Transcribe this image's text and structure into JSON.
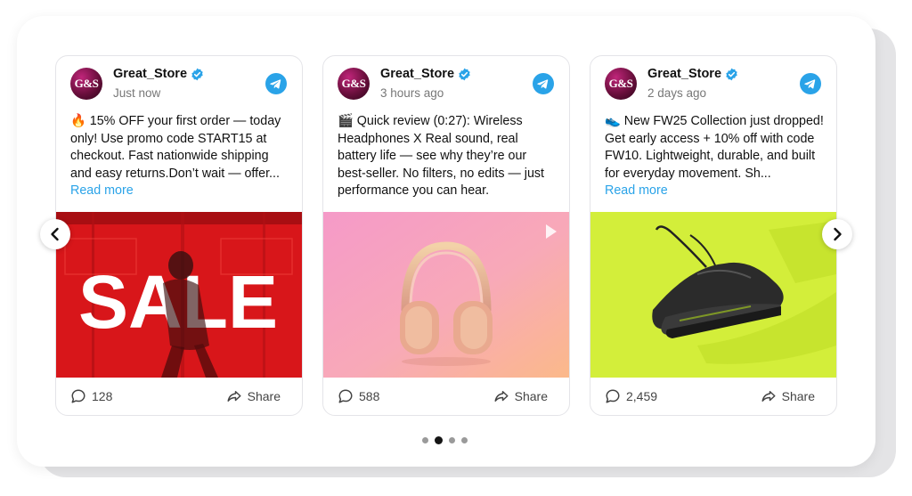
{
  "store": {
    "name": "Great_Store",
    "avatar_text": "G&S"
  },
  "posts": [
    {
      "time": "Just now",
      "text": "🔥 15% OFF your first order — today only! Use promo code START15 at checkout. Fast nationwide shipping and easy returns.Don’t wait — offer...",
      "read_more": "Read more",
      "media": {
        "type": "image",
        "big_text": "SALE",
        "description_icon": "sale-photo"
      },
      "comments": "128",
      "share": "Share"
    },
    {
      "time": "3 hours ago",
      "text": "🎬 Quick review (0:27): Wireless Headphones X Real sound, real battery life — see why they’re our best-seller. No filters, no edits — just performance you can hear.",
      "media": {
        "type": "video",
        "description_icon": "headphones-photo"
      },
      "comments": "588",
      "share": "Share"
    },
    {
      "time": "2 days ago",
      "text": "👟 New FW25 Collection just dropped! Get early access + 10% off with code FW10. Lightweight, durable, and built for everyday movement. Sh...",
      "read_more": "Read more",
      "media": {
        "type": "image",
        "description_icon": "sneaker-photo"
      },
      "comments": "2,459",
      "share": "Share"
    }
  ],
  "carousel": {
    "dots": 4,
    "active_dot": 1,
    "prev_icon": "chevron-left-icon",
    "next_icon": "chevron-right-icon"
  },
  "colors": {
    "accent": "#2aa3e8",
    "verified": "#2aa3e8",
    "sale_red": "#d8161a",
    "headphones_bg": "#f7a6c6",
    "sneaker_bg": "#d3ee3a"
  }
}
